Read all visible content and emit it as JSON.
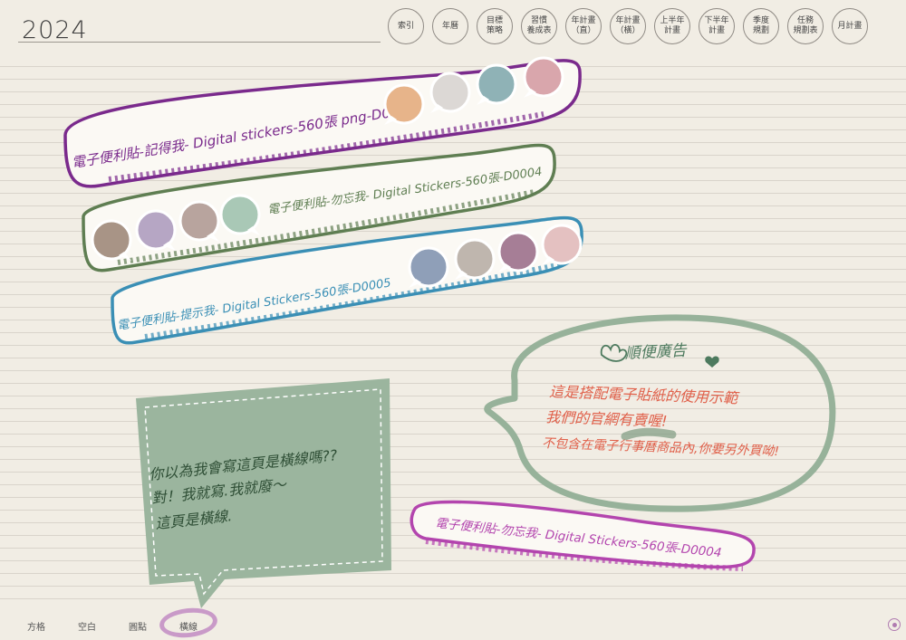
{
  "header": {
    "year": "2024"
  },
  "top_nav": [
    {
      "label": "索引"
    },
    {
      "label": "年曆"
    },
    {
      "label": "目標\n策略"
    },
    {
      "label": "習慣\n養成表"
    },
    {
      "label": "年計畫\n（直）"
    },
    {
      "label": "年計畫\n（橫）"
    },
    {
      "label": "上半年\n計畫"
    },
    {
      "label": "下半年\n計畫"
    },
    {
      "label": "季度\n規劃"
    },
    {
      "label": "任務\n規劃表"
    },
    {
      "label": "月計畫"
    }
  ],
  "stickers": {
    "banner1": {
      "text": "電子便利貼-記得我- Digital stickers-560張 png-D0003",
      "color": "#7a2a8c"
    },
    "banner2": {
      "text": "電子便利貼-勿忘我- Digital Stickers-560張-D0004",
      "color": "#5f7e52"
    },
    "banner3": {
      "text": "電子便利貼-提示我- Digital Stickers-560張-D0005",
      "color": "#3a8fb5"
    },
    "banner4": {
      "text": "電子便利貼-勿忘我- Digital Stickers-560張-D0004",
      "color": "#b345ae"
    },
    "green_note": {
      "line1": "你以為我會寫這頁是橫線嗎??",
      "line2": "對！我就寫.我就廢～",
      "line3": "這頁是橫線.",
      "bg": "#9bb59e"
    },
    "ad_bubble": {
      "title": "順便廣告",
      "line1": "這是搭配電子貼紙的使用示範",
      "line2": "我們的官網有賣喔!",
      "line3": "不包含在電子行事曆商品內,你要另外買呦!",
      "text_color": "#e0604a",
      "title_color": "#4d7a5e",
      "outline": "#97b29a"
    },
    "palette1": [
      "#e7b48a",
      "#dcd8d5",
      "#8fb2b6",
      "#d9a6ac"
    ],
    "palette2": [
      "#a89486",
      "#b6a6c4",
      "#b8a49e",
      "#a9c8b6"
    ],
    "palette3": [
      "#8f9fb8",
      "#bfb6ae",
      "#a67e96",
      "#e4c1c1"
    ]
  },
  "bottom_tabs": [
    {
      "label": "方格"
    },
    {
      "label": "空白"
    },
    {
      "label": "圓點"
    },
    {
      "label": "橫線"
    }
  ]
}
